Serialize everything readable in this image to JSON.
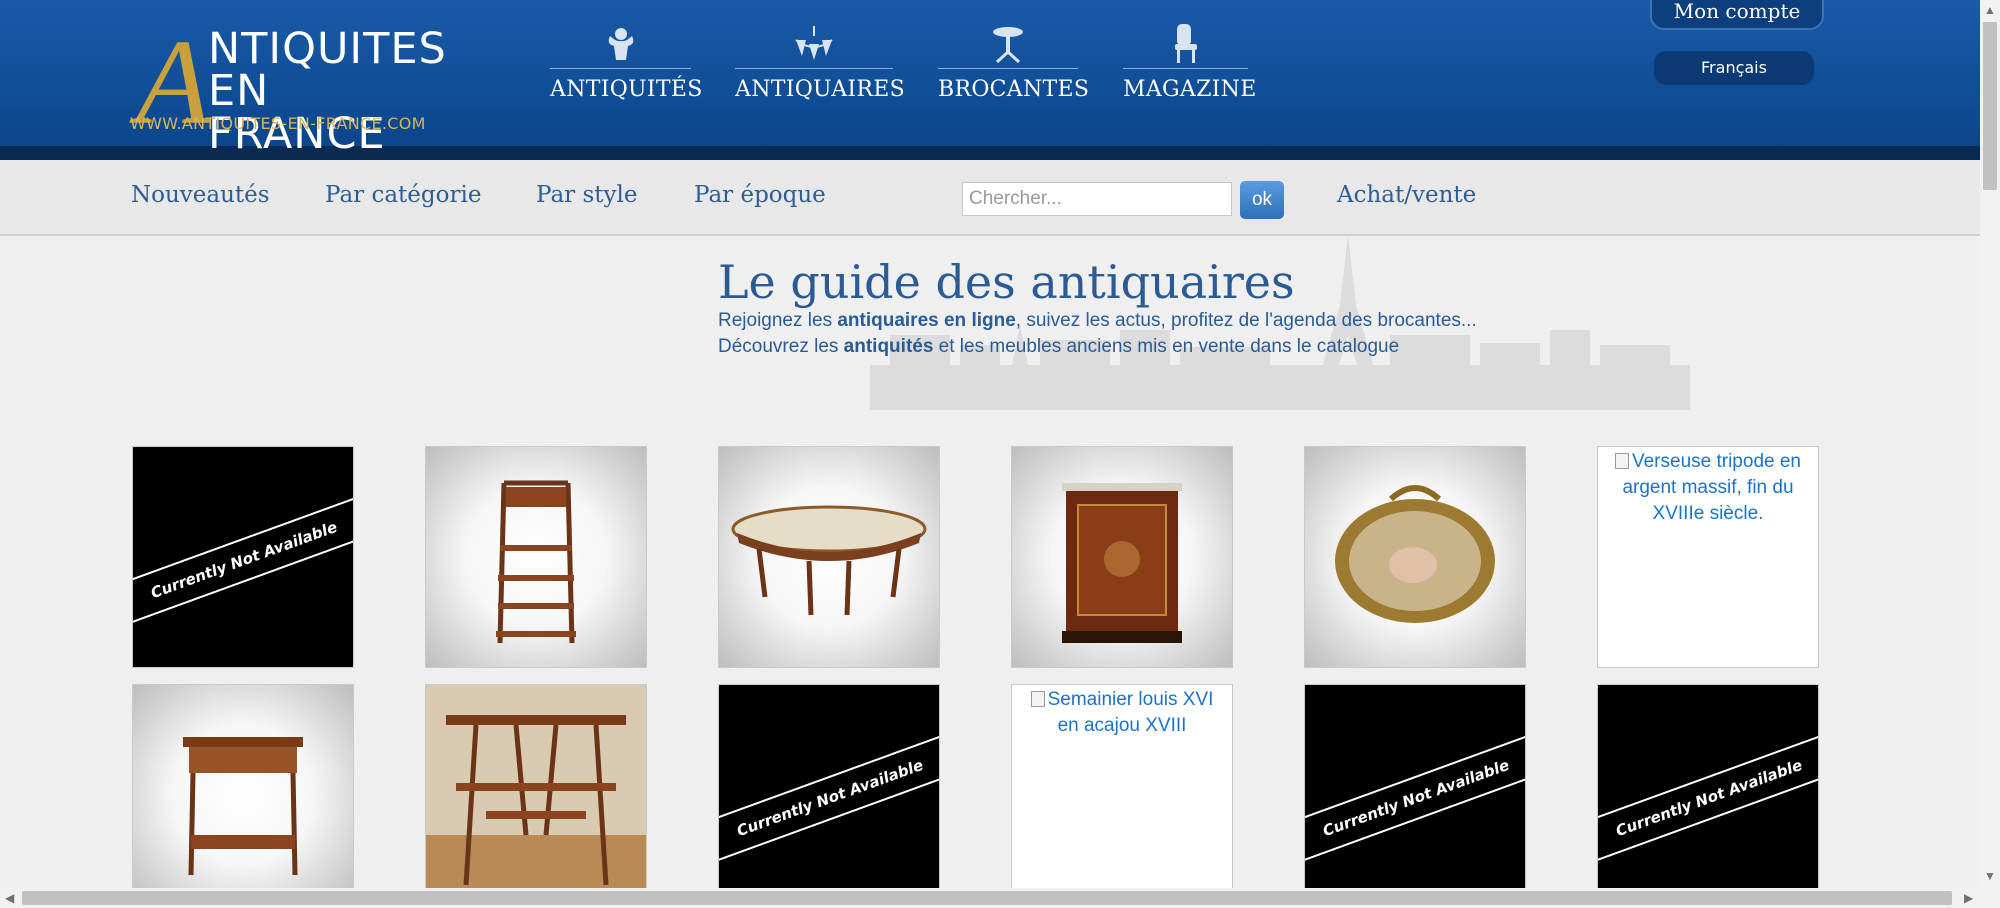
{
  "header": {
    "logo": {
      "big_letter": "A",
      "line1": "NTIQUITES",
      "line2": "EN FRANCE",
      "url": "WWW.ANTIQUITES-EN-FRANCE.COM"
    },
    "nav": [
      {
        "label": "ANTIQUITÉS",
        "icon": "cherub-icon"
      },
      {
        "label": "ANTIQUAIRES",
        "icon": "chandelier-icon"
      },
      {
        "label": "BROCANTES",
        "icon": "pedestal-table-icon"
      },
      {
        "label": "MAGAZINE",
        "icon": "chair-icon"
      }
    ],
    "account": "Mon compte",
    "language": "Français"
  },
  "subnav": {
    "links": [
      "Nouveautés",
      "Par catégorie",
      "Par style",
      "Par époque"
    ],
    "search_placeholder": "Chercher...",
    "search_button": "ok",
    "buy_sell": "Achat/vente"
  },
  "hero": {
    "title": "Le guide des antiquaires",
    "line1_pre": "Rejoignez les ",
    "line1_bold": "antiquaires en ligne",
    "line1_post": ", suivez les actus, profitez de l'agenda des brocantes...",
    "line2_pre": "Découvrez les ",
    "line2_bold": "antiquités",
    "line2_post": " et les meubles anciens mis en vente dans le catalogue"
  },
  "products": {
    "not_available_text": "Currently Not Available",
    "items": [
      {
        "type": "not-available",
        "subject": "unavailable-image"
      },
      {
        "type": "photo",
        "subject": "tall-etagere-image"
      },
      {
        "type": "photo",
        "subject": "oval-marble-table-image"
      },
      {
        "type": "photo",
        "subject": "marquetry-cabinet-image"
      },
      {
        "type": "photo",
        "subject": "gilt-oval-painting-image"
      },
      {
        "type": "broken",
        "alt": "Verseuse tripode en argent massif, fin du XVIIIe siècle."
      },
      {
        "type": "photo",
        "subject": "marquetry-side-table-image"
      },
      {
        "type": "photo",
        "subject": "wooden-side-table-image"
      },
      {
        "type": "not-available",
        "subject": "unavailable-image"
      },
      {
        "type": "broken",
        "alt": "Semainier louis XVI en acajou XVIII"
      },
      {
        "type": "not-available",
        "subject": "unavailable-image"
      },
      {
        "type": "not-available",
        "subject": "unavailable-image"
      }
    ]
  },
  "colors": {
    "header_blue": "#0f4d96",
    "accent_gold": "#c9a13c",
    "link_blue": "#2d5d94"
  }
}
